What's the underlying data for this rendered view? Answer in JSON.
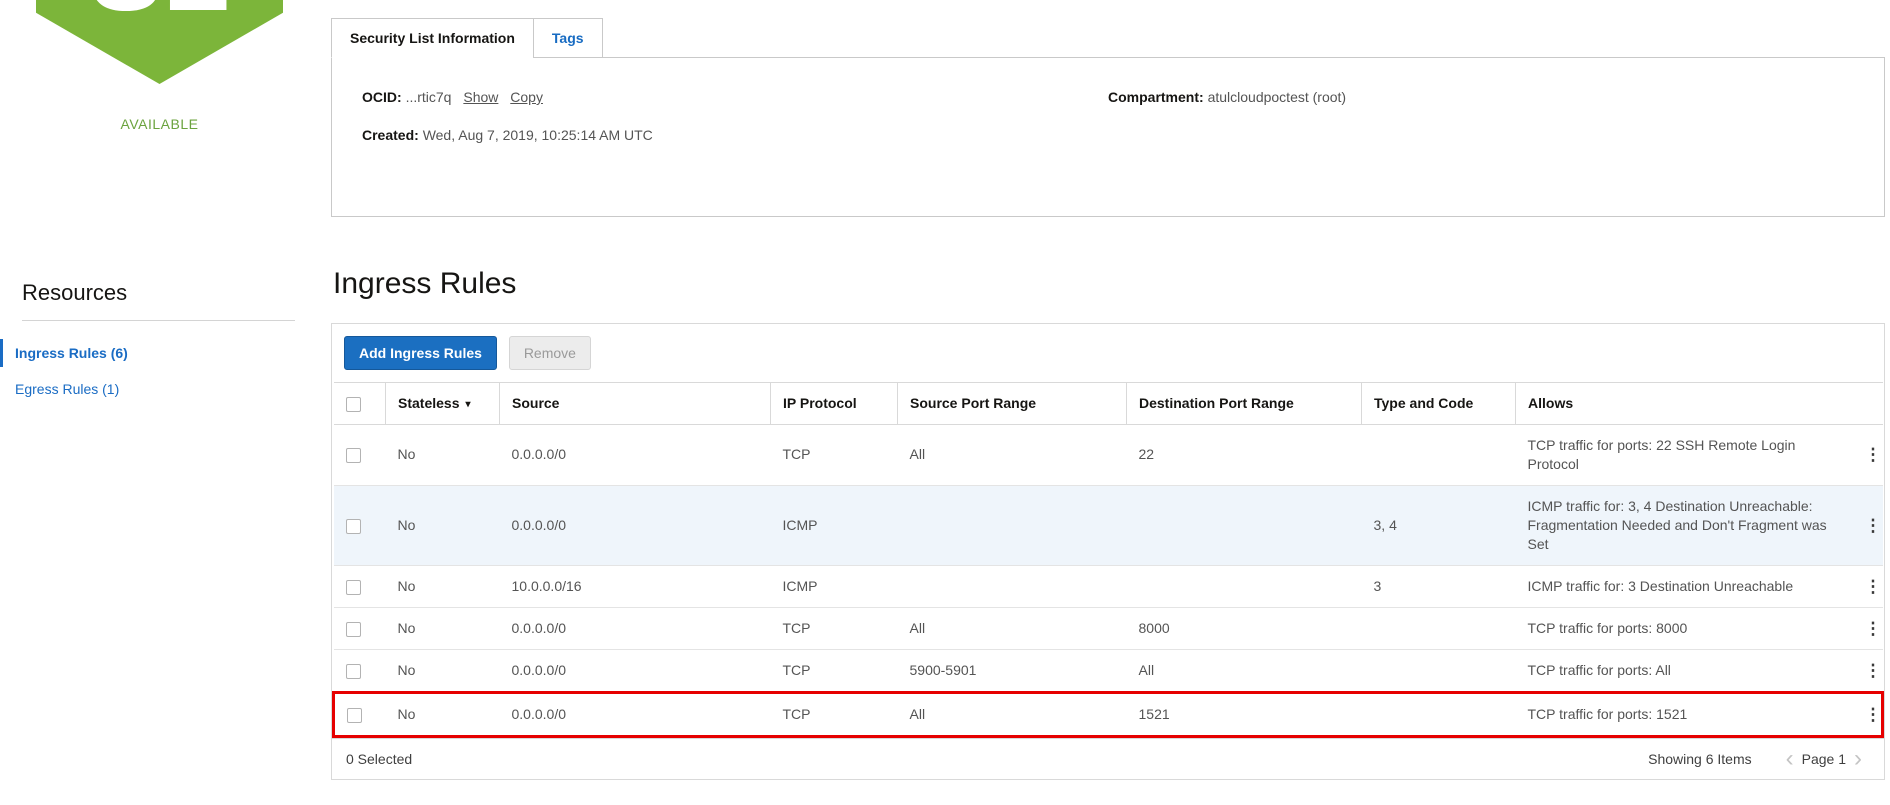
{
  "status_icon": {
    "initials": "SL",
    "label": "AVAILABLE"
  },
  "tabs": {
    "info": "Security List Information",
    "tags": "Tags"
  },
  "details": {
    "ocid_label": "OCID:",
    "ocid_value": "...rtic7q",
    "show_link": "Show",
    "copy_link": "Copy",
    "created_label": "Created:",
    "created_value": "Wed, Aug 7, 2019, 10:25:14 AM UTC",
    "compartment_label": "Compartment:",
    "compartment_value": "atulcloudpoctest (root)"
  },
  "sidebar": {
    "title": "Resources",
    "items": [
      {
        "label": "Ingress Rules (6)"
      },
      {
        "label": "Egress Rules (1)"
      }
    ]
  },
  "ingress": {
    "title": "Ingress Rules",
    "add_button": "Add Ingress Rules",
    "remove_button": "Remove",
    "headers": {
      "stateless": "Stateless",
      "source": "Source",
      "protocol": "IP Protocol",
      "src_port": "Source Port Range",
      "dst_port": "Destination Port Range",
      "type_code": "Type and Code",
      "allows": "Allows"
    },
    "rows": [
      {
        "stateless": "No",
        "source": "0.0.0.0/0",
        "protocol": "TCP",
        "src_port": "All",
        "dst_port": "22",
        "type_code": "",
        "allows": "TCP traffic for ports: 22 SSH Remote Login Protocol"
      },
      {
        "stateless": "No",
        "source": "0.0.0.0/0",
        "protocol": "ICMP",
        "src_port": "",
        "dst_port": "",
        "type_code": "3, 4",
        "allows": "ICMP traffic for: 3, 4 Destination Unreachable: Fragmentation Needed and Don't Fragment was Set"
      },
      {
        "stateless": "No",
        "source": "10.0.0.0/16",
        "protocol": "ICMP",
        "src_port": "",
        "dst_port": "",
        "type_code": "3",
        "allows": "ICMP traffic for: 3 Destination Unreachable"
      },
      {
        "stateless": "No",
        "source": "0.0.0.0/0",
        "protocol": "TCP",
        "src_port": "All",
        "dst_port": "8000",
        "type_code": "",
        "allows": "TCP traffic for ports: 8000"
      },
      {
        "stateless": "No",
        "source": "0.0.0.0/0",
        "protocol": "TCP",
        "src_port": "5900-5901",
        "dst_port": "All",
        "type_code": "",
        "allows": "TCP traffic for ports: All"
      },
      {
        "stateless": "No",
        "source": "0.0.0.0/0",
        "protocol": "TCP",
        "src_port": "All",
        "dst_port": "1521",
        "type_code": "",
        "allows": "TCP traffic for ports: 1521"
      }
    ],
    "footer": {
      "selected": "0 Selected",
      "showing": "Showing 6 Items",
      "page": "Page 1"
    }
  },
  "icons": {
    "sort_caret": "▾",
    "kebab": "⋮",
    "chevron_left": "‹",
    "chevron_right": "›"
  },
  "colors": {
    "accent_blue": "#1a6cc4",
    "button_blue": "#1b6fc1",
    "status_green": "#7cb53a",
    "highlight_red": "#e60000",
    "shaded_row": "#eff5fb"
  }
}
